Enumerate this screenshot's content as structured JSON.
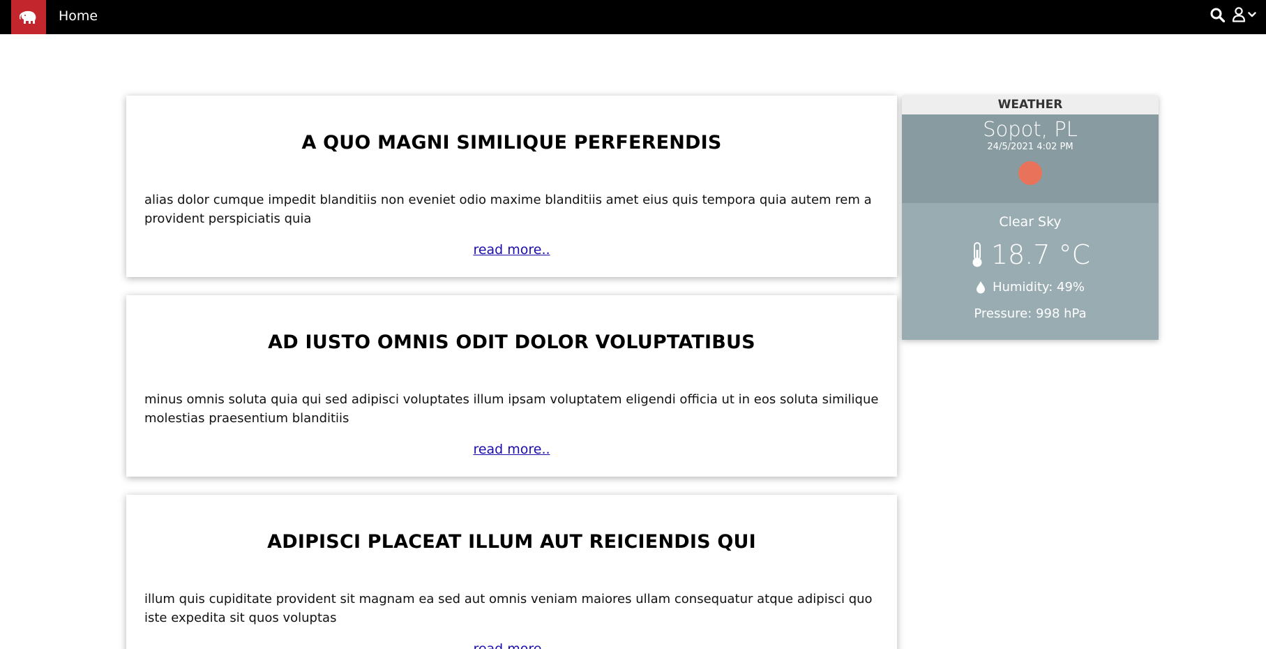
{
  "nav": {
    "home_label": "Home",
    "icons": [
      "elephant-logo-icon",
      "search-icon",
      "user-icon",
      "chevron-down-icon"
    ],
    "bar_color": "#000000",
    "brand_color": "#c4262e"
  },
  "posts": [
    {
      "title": "A QUO MAGNI SIMILIQUE PERFERENDIS",
      "body": "alias dolor cumque impedit blanditiis non eveniet odio maxime blanditiis amet eius quis tempora quia autem rem a provident perspiciatis quia",
      "link": "read more.."
    },
    {
      "title": "AD IUSTO OMNIS ODIT DOLOR VOLUPTATIBUS",
      "body": "minus omnis soluta quia qui sed adipisci voluptates illum ipsam voluptatem eligendi officia ut in eos soluta similique molestias praesentium blanditiis",
      "link": "read more.."
    },
    {
      "title": "ADIPISCI PLACEAT ILLUM AUT REICIENDIS QUI",
      "body": "illum quis cupiditate provident sit magnam ea sed aut omnis veniam maiores ullam consequatur atque adipisci quo iste expedita sit quos voluptas",
      "link": "read more.."
    }
  ],
  "weather": {
    "header": "WEATHER",
    "city": "Sopot, PL",
    "datetime": "24/5/2021 4:02 PM",
    "condition": "Clear Sky",
    "temperature": "18.7 °C",
    "humidity": "Humidity: 49%",
    "pressure": "Pressure: 998 hPa",
    "icons": [
      "sun-icon",
      "thermometer-icon",
      "droplet-icon"
    ],
    "colors": {
      "top": "#889ba0",
      "bottom": "#98acb2",
      "sun": "#e8735a"
    }
  }
}
